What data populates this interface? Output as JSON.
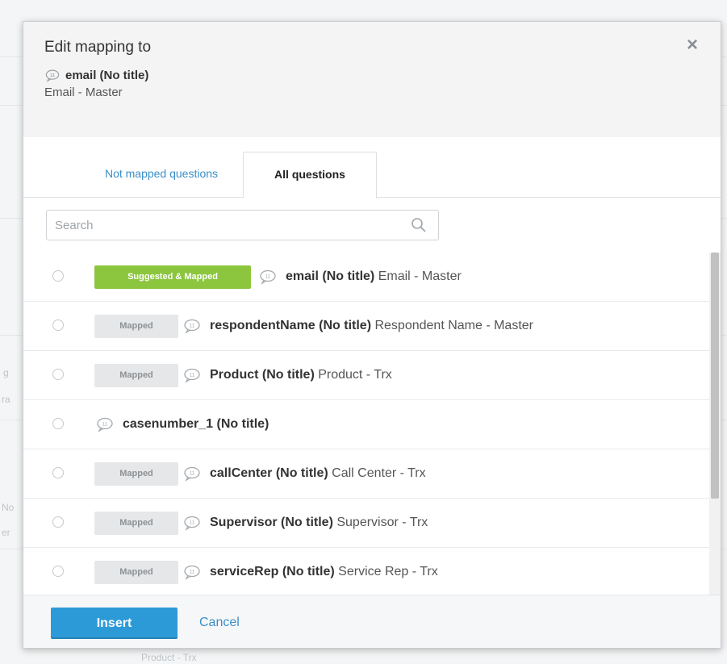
{
  "background": {
    "texts": [
      "g",
      "ra",
      "No",
      "er",
      "Product - Trx"
    ]
  },
  "modal": {
    "title": "Edit mapping to",
    "target_name": "email (No title)",
    "target_desc": "Email - Master",
    "close_label": "×"
  },
  "tabs": [
    {
      "label": "Not mapped questions",
      "active": false
    },
    {
      "label": "All questions",
      "active": true
    }
  ],
  "search": {
    "placeholder": "Search",
    "value": ""
  },
  "questions": [
    {
      "badge": "Suggested & Mapped",
      "badge_style": "green",
      "name": "email (No title)",
      "desc": "Email - Master"
    },
    {
      "badge": "Mapped",
      "badge_style": "gray",
      "name": "respondentName (No title)",
      "desc": "Respondent Name - Master"
    },
    {
      "badge": "Mapped",
      "badge_style": "gray",
      "name": "Product (No title)",
      "desc": "Product - Trx"
    },
    {
      "badge": "",
      "badge_style": "none",
      "name": "casenumber_1 (No title)",
      "desc": ""
    },
    {
      "badge": "Mapped",
      "badge_style": "gray",
      "name": "callCenter (No title)",
      "desc": "Call Center - Trx"
    },
    {
      "badge": "Mapped",
      "badge_style": "gray",
      "name": "Supervisor (No title)",
      "desc": "Supervisor - Trx"
    },
    {
      "badge": "Mapped",
      "badge_style": "gray",
      "name": "serviceRep (No title)",
      "desc": "Service Rep - Trx"
    }
  ],
  "footer": {
    "insert_label": "Insert",
    "cancel_label": "Cancel"
  },
  "colors": {
    "accent": "#2d9ad8",
    "link": "#3a8fc7",
    "badge_green": "#8cc63f",
    "badge_gray": "#e6e7e8"
  },
  "icons": {
    "question": "speech-bubble-icon",
    "search": "search-icon",
    "close": "close-icon"
  }
}
